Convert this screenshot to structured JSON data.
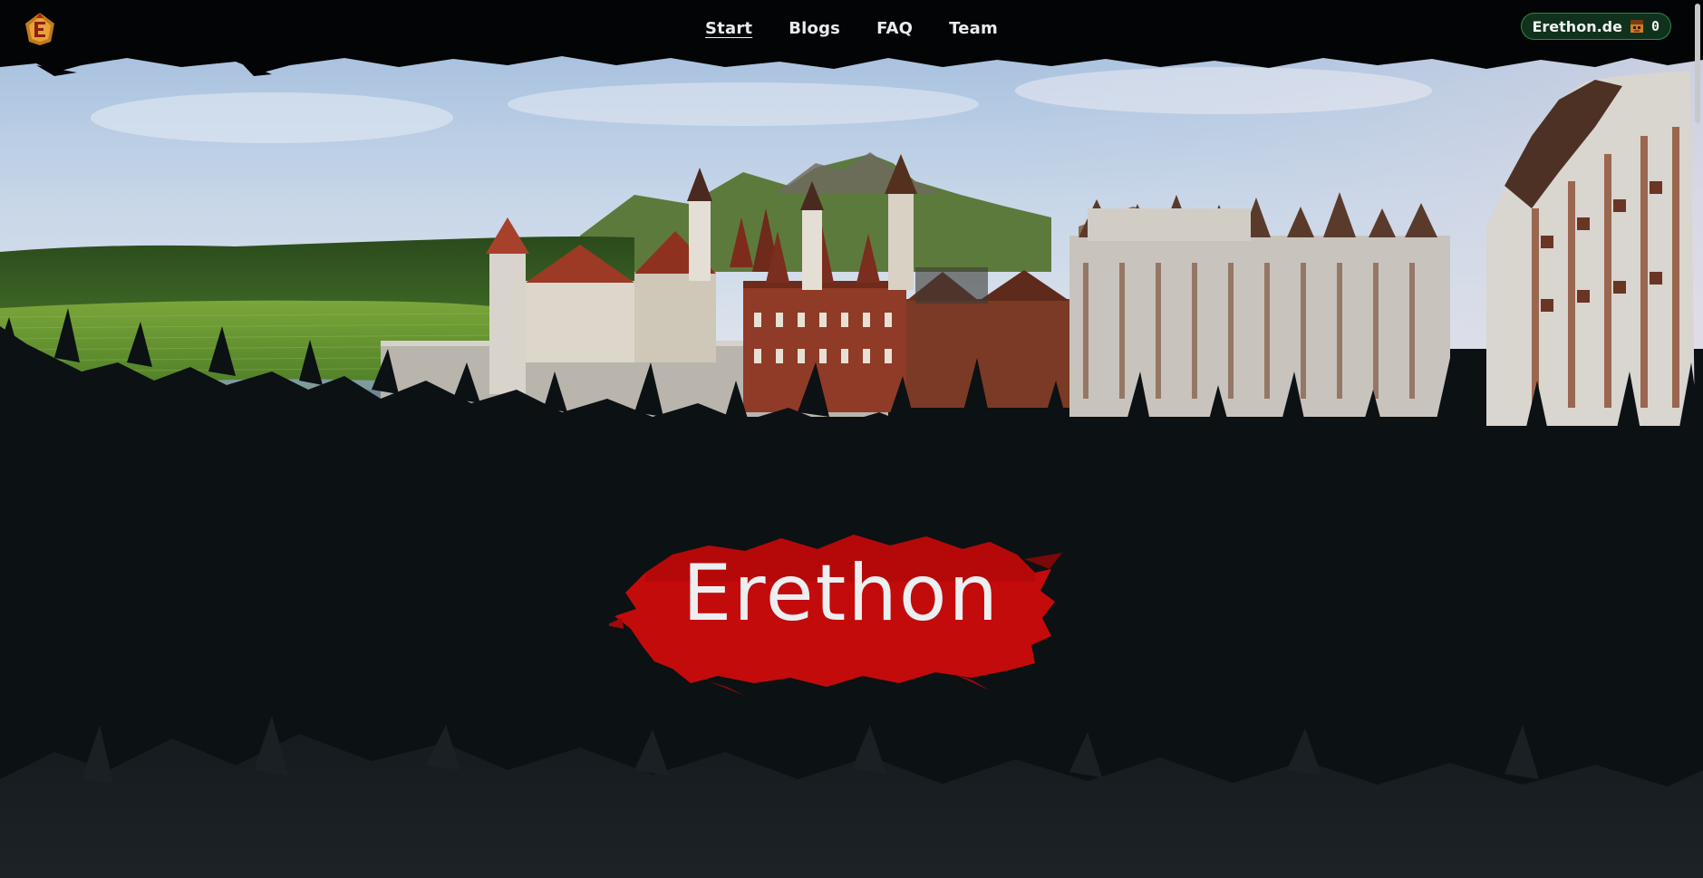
{
  "nav": {
    "logo_icon": "erethon-dragon-logo-icon",
    "links": [
      {
        "label": "Start",
        "active": true
      },
      {
        "label": "Blogs",
        "active": false
      },
      {
        "label": "FAQ",
        "active": false
      },
      {
        "label": "Team",
        "active": false
      }
    ],
    "server": {
      "name": "Erethon.de",
      "icon": "player-head-icon",
      "count": "0"
    }
  },
  "hero": {
    "title": "Erethon",
    "scene": "minecraft-castle-city-panorama"
  },
  "colors": {
    "nav_bg": "#030405",
    "page_bg": "#0c1114",
    "accent_red": "#c30b0b",
    "pill_bg": "#10321c",
    "pill_border": "#2d8a47"
  }
}
